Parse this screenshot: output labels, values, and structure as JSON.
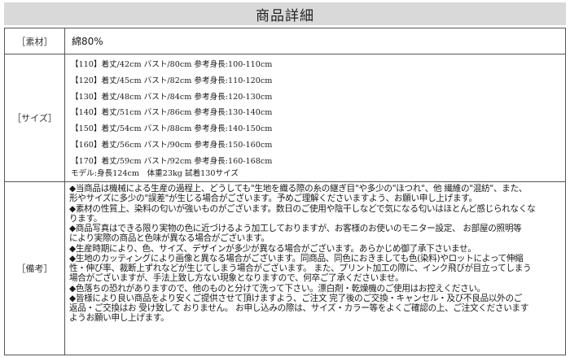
{
  "title": "商品詳細",
  "material": {
    "label": "［素材］",
    "value": "綿80%"
  },
  "size": {
    "label": "［サイズ］",
    "rows": [
      "【110】着丈/42cm バスト/80cm 参考身長:100-110cm",
      "【120】着丈/45cm バスト/82cm 参考身長:110-120cm",
      "【130】着丈/48cm バスト/84cm 参考身長:120-130cm",
      "【140】着丈/51cm バスト/86cm 参考身長:130-140cm",
      "【150】着丈/54cm バスト/88cm 参考身長:140-150cm",
      "【160】着丈/56cm バスト/90cm 参考身長:150-160cm",
      "【170】着丈/59cm バスト/92cm 参考身長:160-168cm"
    ],
    "model_note": "モデル:身長124cm　体重23kg 試着130サイズ"
  },
  "notes": {
    "label": "［備考］",
    "lines": [
      "◆当商品は機械による生産の過程上、どうしても\"生地を織る際の糸の継ぎ目\"や多少の\"ほつれ\"、他 繊維の\"混紡\"、また、",
      "形やサイズに多少の\"誤差\"が生じる場合がございます。予めご理解くださいますよう、お願い申し上げます。",
      "◆素材の性質上、染料の匂いが強いものがございます。数日のご使用や陰干しなどで気になる匂いはほとんど感じられなくな",
      "ります。",
      "◆商品写真はできる限り実物の色に近づけるよう加工しておりますが、お客様のお使いのモニター設定、 お部屋の照明等",
      "により実際の商品と色味が異なる場合がございます。",
      "◆生産時期により、色、サイズ、デザインが多少が異なる場合がございます。あらかじめ御了承下さいませ。",
      "◆生地のカッティングにより画像と異なる場合がございます。同商品、同色におきましても色(染料)やロットによって伸縮",
      "性・伸び率、裁断上ずれなどが生じてしまう場合がございます。 また、プリント加工の際に、インク飛びが目立ってしまう",
      "場合がございますが、手法上致し方ない現象となりますので、何卒ご了承くださいませ。",
      "◆色落ちの恐れがありますので、他のものと分けて洗って下さい。漂白剤・乾燥機のご使用はお控えください。",
      "◆皆様により良い商品をより安くご提供させて頂けますよう、ご注文 完了後のご交換・キャンセル・及び不良品以外のご",
      "返品・ご交換はお 受け致して おりません。 お申し込みの際は、サイズ・カラー等をよくご確認の上、ご注文くださいます",
      "ようお願い申し上げます。"
    ]
  }
}
